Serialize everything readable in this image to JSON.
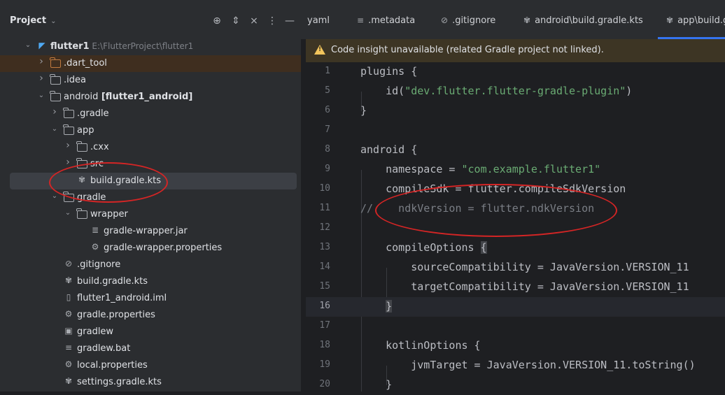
{
  "project_panel": {
    "title": "Project",
    "tree": [
      {
        "name": "flutter1",
        "path": "E:\\FlutterProject\\flutter1",
        "icon": "flutter-logo-icon",
        "expanded": true
      },
      {
        "name": ".dart_tool",
        "icon": "folder-icon",
        "excluded": true
      },
      {
        "name": ".idea",
        "icon": "folder-icon"
      },
      {
        "name": "android",
        "module": "[flutter1_android]",
        "icon": "folder-icon",
        "expanded": true
      },
      {
        "name": ".gradle",
        "icon": "folder-icon"
      },
      {
        "name": "app",
        "icon": "folder-icon",
        "expanded": true
      },
      {
        "name": ".cxx",
        "icon": "folder-icon"
      },
      {
        "name": "src",
        "icon": "folder-icon"
      },
      {
        "name": "build.gradle.kts",
        "icon": "gradle-kts-icon",
        "selected": true
      },
      {
        "name": "gradle",
        "icon": "folder-icon",
        "expanded": true
      },
      {
        "name": "wrapper",
        "icon": "folder-icon",
        "expanded": true
      },
      {
        "name": "gradle-wrapper.jar",
        "icon": "jar-icon"
      },
      {
        "name": "gradle-wrapper.properties",
        "icon": "settings-gear-icon"
      },
      {
        "name": ".gitignore",
        "icon": "gitignore-icon"
      },
      {
        "name": "build.gradle.kts",
        "icon": "gradle-kts-icon"
      },
      {
        "name": "flutter1_android.iml",
        "icon": "iml-file-icon"
      },
      {
        "name": "gradle.properties",
        "icon": "settings-gear-icon"
      },
      {
        "name": "gradlew",
        "icon": "terminal-icon"
      },
      {
        "name": "gradlew.bat",
        "icon": "text-lines-icon"
      },
      {
        "name": "local.properties",
        "icon": "settings-gear-icon"
      },
      {
        "name": "settings.gradle.kts",
        "icon": "gradle-kts-icon"
      }
    ]
  },
  "tabs": [
    {
      "label": "yaml",
      "icon": ""
    },
    {
      "label": ".metadata",
      "icon": "text-lines-icon"
    },
    {
      "label": ".gitignore",
      "icon": "gitignore-icon"
    },
    {
      "label": "android\\build.gradle.kts",
      "icon": "gradle-kts-icon"
    },
    {
      "label": "app\\build.gradle.kts",
      "icon": "gradle-kts-icon",
      "active": true
    }
  ],
  "banner": {
    "text": "Code insight unavailable (related Gradle project not linked).",
    "icon": "warning-icon"
  },
  "editor": {
    "current_line": "16",
    "lines": [
      {
        "n": "1",
        "text": "plugins {"
      },
      {
        "n": "5",
        "pre": "    id(",
        "str": "\"dev.flutter.flutter-gradle-plugin\"",
        "post": ")"
      },
      {
        "n": "6",
        "text": "}"
      },
      {
        "n": "7",
        "text": ""
      },
      {
        "n": "8",
        "text": "android {"
      },
      {
        "n": "9",
        "pre": "    namespace = ",
        "str": "\"com.example.flutter1\"",
        "post": ""
      },
      {
        "n": "10",
        "text": "    compileSdk = flutter.compileSdkVersion"
      },
      {
        "n": "11",
        "comment": "//    ndkVersion = flutter.ndkVersion"
      },
      {
        "n": "12",
        "text": ""
      },
      {
        "n": "13",
        "pre": "    compileOptions ",
        "brk": "{",
        "post": ""
      },
      {
        "n": "14",
        "text": "        sourceCompatibility = JavaVersion.VERSION_11"
      },
      {
        "n": "15",
        "text": "        targetCompatibility = JavaVersion.VERSION_11"
      },
      {
        "n": "16",
        "pre": "    ",
        "brk": "}",
        "post": ""
      },
      {
        "n": "17",
        "text": ""
      },
      {
        "n": "18",
        "text": "    kotlinOptions {"
      },
      {
        "n": "19",
        "text": "        jvmTarget = JavaVersion.VERSION_11.toString()"
      },
      {
        "n": "20",
        "text": "    }"
      }
    ]
  },
  "colors": {
    "accent": "#3574f0",
    "annotation": "#d42525",
    "warning": "#f2c55c",
    "string": "#6aab73",
    "comment": "#7a7e85"
  }
}
